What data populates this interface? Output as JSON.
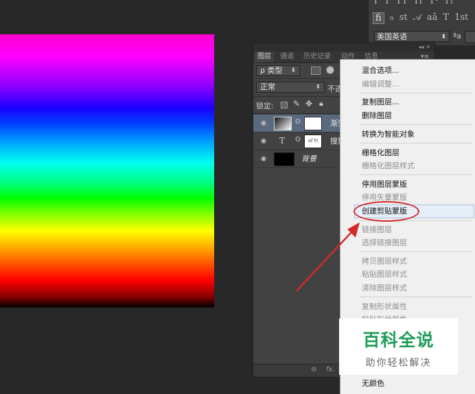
{
  "character_panel": {
    "row1": [
      "T",
      "T",
      "TT",
      "Tr",
      "T¹",
      "T₁"
    ],
    "row2": [
      "fi",
      "ℴ",
      "st",
      "𝒜",
      "aā",
      "T",
      "1st"
    ],
    "language": "美国英语",
    "aa_label": "ªa"
  },
  "layers_panel": {
    "collapse_label": "◂◂  ✕",
    "tabs": [
      "图层",
      "通道",
      "历史记录",
      "动作",
      "信息"
    ],
    "menu_icon": "▾≡",
    "filter_kind": "ρ 类型",
    "blend_mode": "正常",
    "opacity_label": "不透",
    "lock_label": "锁定:",
    "layers": [
      {
        "name": "渐变",
        "selected": true
      },
      {
        "name": "搜狐",
        "selected": false
      },
      {
        "name": "背景",
        "selected": false
      }
    ],
    "text_layer_thumb_text": "s矿时",
    "text_layer_icon": "T",
    "footer_link": "⊖",
    "footer_fx": "fx."
  },
  "context_menu": {
    "items": [
      {
        "label": "混合选项...",
        "enabled": true
      },
      {
        "label": "编辑调整...",
        "enabled": false
      },
      {
        "label": "复制图层...",
        "enabled": true
      },
      {
        "label": "删除图层",
        "enabled": true
      },
      {
        "label": "转换为智能对象",
        "enabled": true
      },
      {
        "label": "栅格化图层",
        "enabled": true
      },
      {
        "label": "栅格化图层样式",
        "enabled": false
      },
      {
        "label": "停用图层蒙版",
        "enabled": true
      },
      {
        "label": "停用矢量蒙版",
        "enabled": false
      },
      {
        "label": "创建剪贴蒙版",
        "enabled": true,
        "highlighted": true
      },
      {
        "label": "链接图层",
        "enabled": false
      },
      {
        "label": "选择链接图层",
        "enabled": false
      },
      {
        "label": "拷贝图层样式",
        "enabled": false
      },
      {
        "label": "粘贴图层样式",
        "enabled": false
      },
      {
        "label": "清除图层样式",
        "enabled": false
      },
      {
        "label": "复制形状属性",
        "enabled": false
      },
      {
        "label": "粘贴形状属性",
        "enabled": false
      },
      {
        "label": "无颜色",
        "enabled": true
      }
    ]
  },
  "watermark": {
    "title": "百科全说",
    "subtitle": "助你轻松解决"
  },
  "colors": {
    "annotation_red": "#d12a2a",
    "watermark_green": "#1f9d57",
    "selected_layer": "#5a6a7e"
  }
}
